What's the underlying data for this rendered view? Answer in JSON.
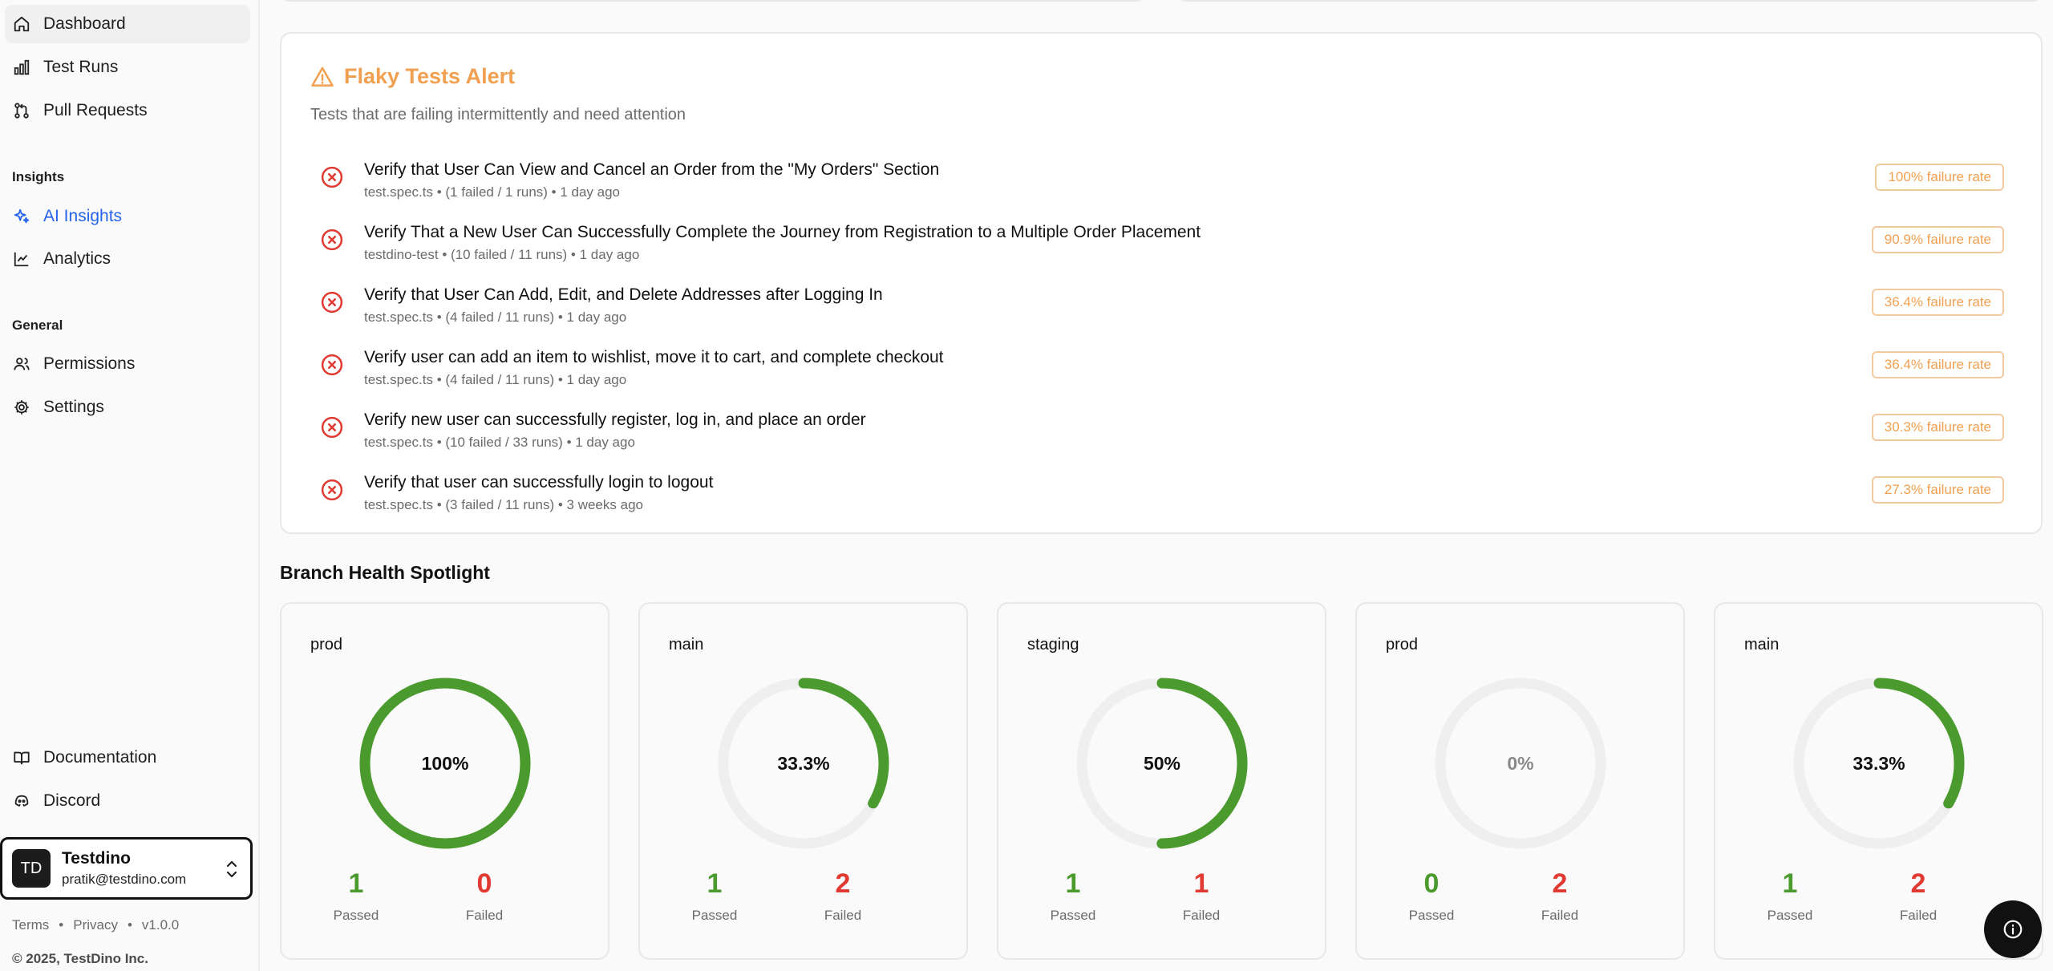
{
  "sidebar": {
    "nav": [
      {
        "label": "Dashboard",
        "icon": "home-icon"
      },
      {
        "label": "Test Runs",
        "icon": "bar-chart-icon"
      },
      {
        "label": "Pull Requests",
        "icon": "git-pull-request-icon"
      }
    ],
    "insights_label": "Insights",
    "insights": [
      {
        "label": "AI Insights",
        "icon": "sparkles-icon"
      },
      {
        "label": "Analytics",
        "icon": "line-chart-icon"
      }
    ],
    "general_label": "General",
    "general": [
      {
        "label": "Permissions",
        "icon": "users-icon"
      },
      {
        "label": "Settings",
        "icon": "gear-icon"
      }
    ],
    "bottom": [
      {
        "label": "Documentation",
        "icon": "book-icon"
      },
      {
        "label": "Discord",
        "icon": "discord-icon"
      }
    ],
    "user": {
      "initials": "TD",
      "name": "Testdino",
      "email": "pratik@testdino.com"
    },
    "footer": {
      "terms": "Terms",
      "privacy": "Privacy",
      "version": "v1.0.0",
      "separator": "•",
      "copyright": "© 2025, TestDino Inc."
    }
  },
  "flaky": {
    "title": "Flaky Tests Alert",
    "subtitle": "Tests that are failing intermittently and need attention",
    "accent": "#f0a050",
    "tests": [
      {
        "name": "Verify that User Can View and Cancel an Order from the \"My Orders\" Section",
        "meta": "test.spec.ts • (1 failed / 1 runs) • 1 day ago",
        "rate": "100% failure rate"
      },
      {
        "name": "Verify That a New User Can Successfully Complete the Journey from Registration to a Multiple Order Placement",
        "meta": "testdino-test • (10 failed / 11 runs) • 1 day ago",
        "rate": "90.9% failure rate"
      },
      {
        "name": "Verify that User Can Add, Edit, and Delete Addresses after Logging In",
        "meta": "test.spec.ts • (4 failed / 11 runs) • 1 day ago",
        "rate": "36.4% failure rate"
      },
      {
        "name": "Verify user can add an item to wishlist, move it to cart, and complete checkout",
        "meta": "test.spec.ts • (4 failed / 11 runs) • 1 day ago",
        "rate": "36.4% failure rate"
      },
      {
        "name": "Verify new user can successfully register, log in, and place an order",
        "meta": "test.spec.ts • (10 failed / 33 runs) • 1 day ago",
        "rate": "30.3% failure rate"
      },
      {
        "name": "Verify that user can successfully login to logout",
        "meta": "test.spec.ts • (3 failed / 11 runs) • 3 weeks ago",
        "rate": "27.3% failure rate"
      }
    ]
  },
  "branch_health": {
    "title": "Branch Health Spotlight",
    "passed_label": "Passed",
    "failed_label": "Failed",
    "pass_color": "#4a9a2e",
    "fail_color": "#e03a32",
    "branches": [
      {
        "name": "prod",
        "percent_label": "100%",
        "pass_fraction": 1.0,
        "passed": "1",
        "failed": "0"
      },
      {
        "name": "main",
        "percent_label": "33.3%",
        "pass_fraction": 0.333,
        "passed": "1",
        "failed": "2"
      },
      {
        "name": "staging",
        "percent_label": "50%",
        "pass_fraction": 0.5,
        "passed": "1",
        "failed": "1"
      },
      {
        "name": "prod",
        "percent_label": "0%",
        "pass_fraction": 0.0,
        "passed": "0",
        "failed": "2"
      },
      {
        "name": "main",
        "percent_label": "33.3%",
        "pass_fraction": 0.333,
        "passed": "1",
        "failed": "2"
      }
    ]
  }
}
